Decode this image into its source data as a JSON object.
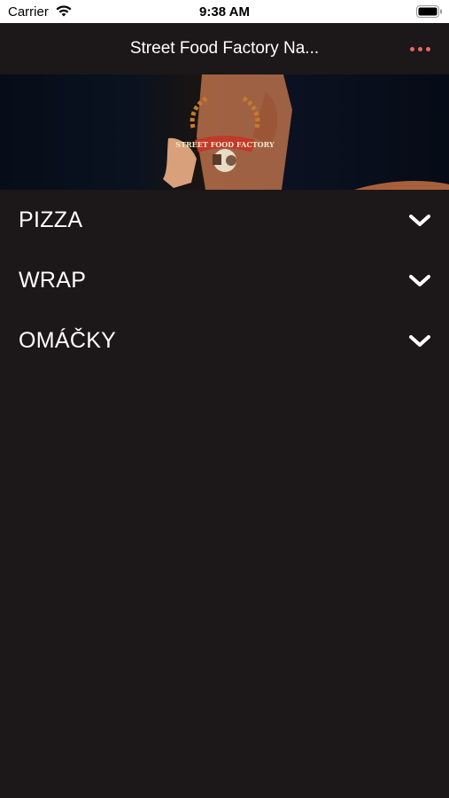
{
  "status_bar": {
    "carrier": "Carrier",
    "time": "9:38 AM"
  },
  "nav": {
    "title": "Street Food Factory Na...",
    "more_icon": "ellipsis-icon",
    "accent_color": "#e36b63"
  },
  "banner": {
    "logo_text": "STREET FOOD FACTORY"
  },
  "menu": {
    "items": [
      {
        "label": "PIZZA",
        "icon": "chevron-down-icon"
      },
      {
        "label": "WRAP",
        "icon": "chevron-down-icon"
      },
      {
        "label": "OMÁČKY",
        "icon": "chevron-down-icon"
      }
    ]
  },
  "colors": {
    "background": "#1c1718",
    "text": "#ffffff"
  }
}
